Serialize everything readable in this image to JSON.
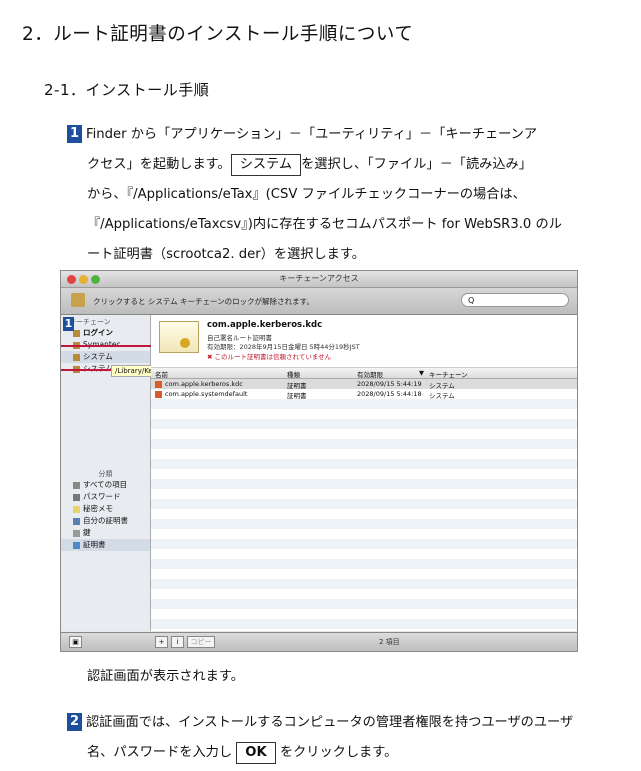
{
  "heading": "2．ルート証明書のインストール手順について",
  "subheading": "2-1．インストール手順",
  "step1": {
    "badge": "1",
    "line1_a": "Finder から「アプリケーション」－「ユーティリティ」－「キーチェーンア",
    "line2_a": "クセス」を起動します。",
    "line2_box": "システム",
    "line2_b": "を選択し、「ファイル」－「読み込み」",
    "line3": "から、『/Applications/eTax』(CSV ファイルチェックコーナーの場合は、",
    "line4": "『/Applications/eTaxcsv』)内に存在するセコムパスポート for WebSR3.0 のル",
    "line5": "ート証明書（scrootca2. der）を選択します。"
  },
  "screenshot": {
    "window_title": "キーチェーンアクセス",
    "toolbar_text": "クリックすると システム キーチェーンのロックが解除されます。",
    "search_glyph": "Q",
    "sidebar": {
      "keychain_header": "キーチェーン",
      "keychains": [
        "ログイン",
        "Symantec",
        "システム",
        "システムルート"
      ],
      "category_header": "分類",
      "categories": [
        "すべての項目",
        "パスワード",
        "秘密メモ",
        "自分の証明書",
        "鍵",
        "証明書"
      ]
    },
    "tooltip": "/Library/Keychains/System.keychain",
    "badge": "1",
    "cert": {
      "title": "com.apple.kerberos.kdc",
      "line1": "自己署名ルート証明書",
      "line2": "有効期限：2028年9月15日金曜日 5時44分19秒JST",
      "warning": "このルート証明書は信頼されていません"
    },
    "columns": [
      "名前",
      "種類",
      "有効期限",
      "キーチェーン"
    ],
    "rows": [
      {
        "name": "com.apple.kerberos.kdc",
        "kind": "証明書",
        "expires": "2028/09/15 5:44:19",
        "keychain": "システム"
      },
      {
        "name": "com.apple.systemdefault",
        "kind": "証明書",
        "expires": "2028/09/15 5:44:18",
        "keychain": "システム"
      }
    ],
    "bottom_count": "2 項目",
    "copy_btn": "コピー"
  },
  "after_text": "認証画面が表示されます。",
  "step2": {
    "badge": "2",
    "line1": "認証画面では、インストールするコンピュータの管理者権限を持つユーザのユーザ",
    "line2_a": "名、パスワードを入力し",
    "line2_box": "OK",
    "line2_b": "をクリックします。"
  }
}
